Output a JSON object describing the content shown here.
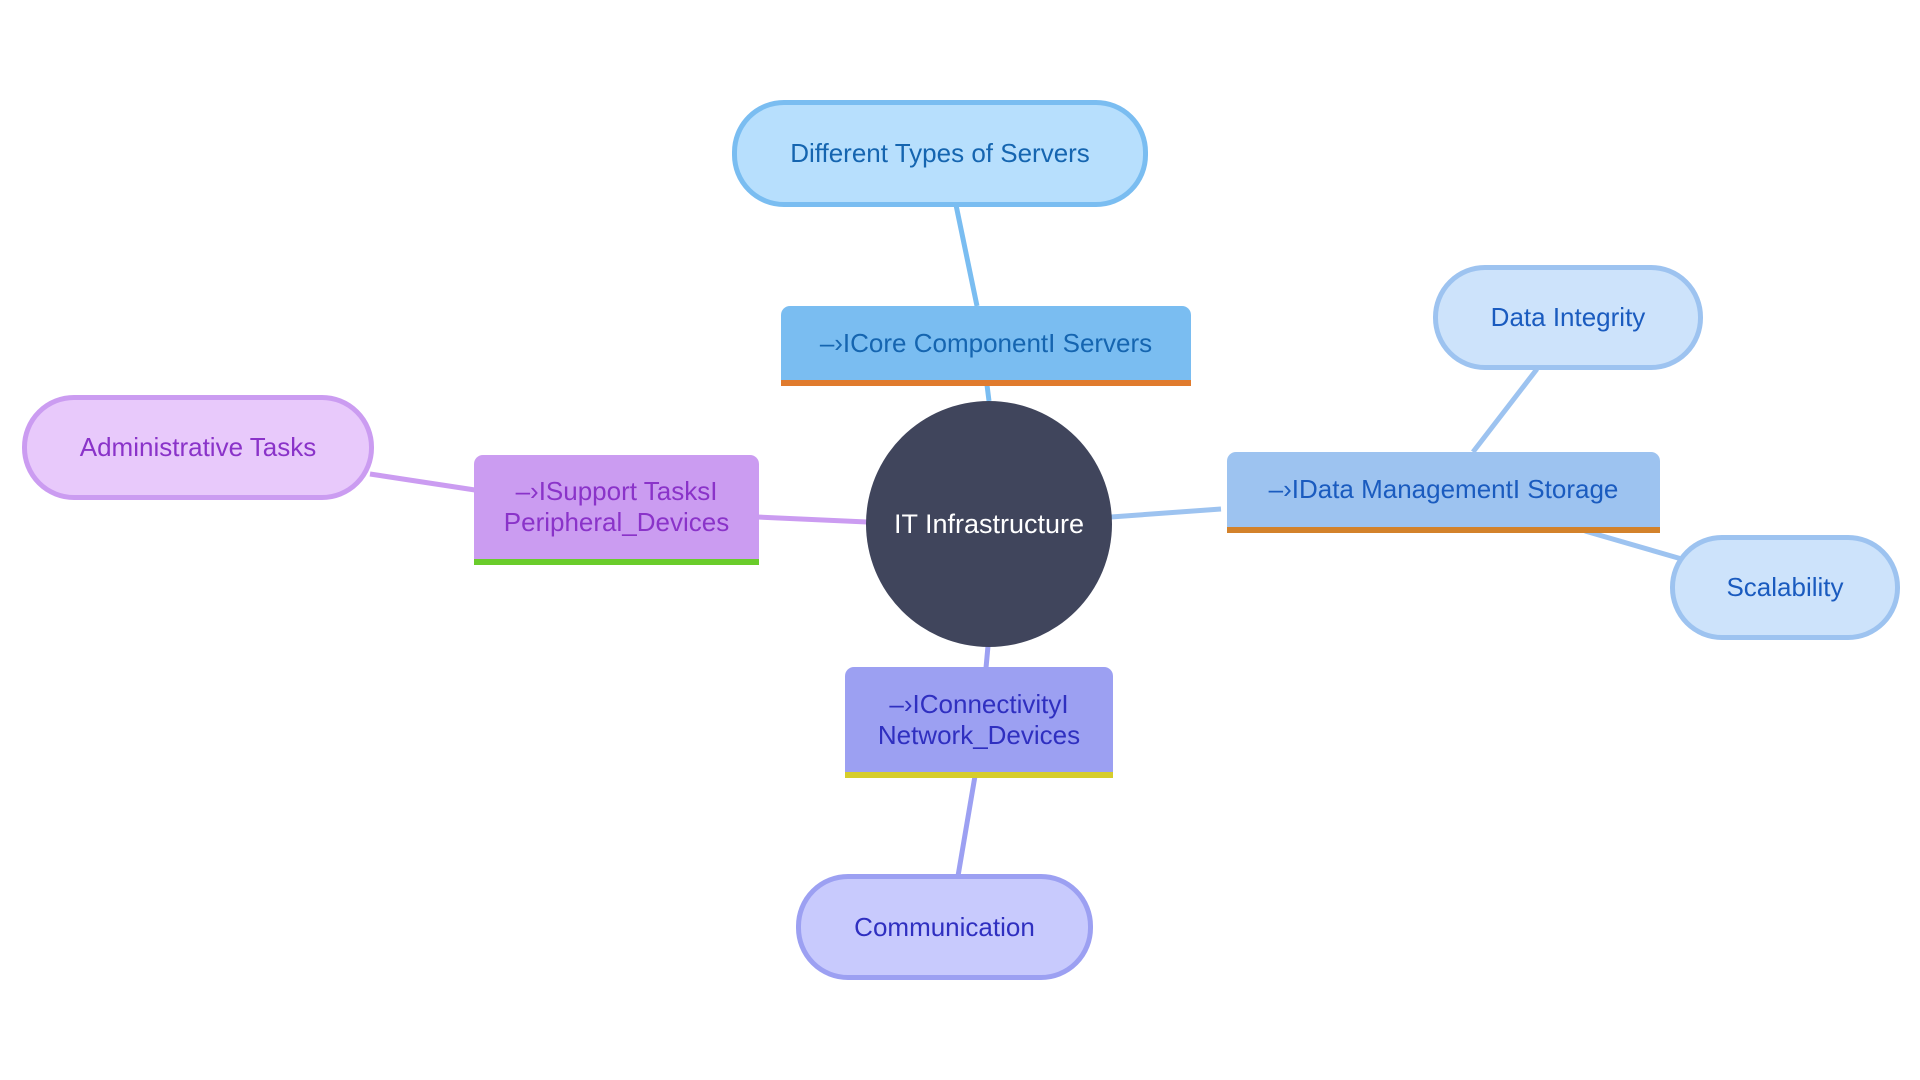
{
  "diagram": {
    "type": "mindmap",
    "root": {
      "label": "IT Infrastructure",
      "fill": "#40455c",
      "text_color": "#ffffff"
    },
    "branches": [
      {
        "id": "servers",
        "label": "–›ICore ComponentI Servers",
        "fill": "#7abdf1",
        "underline": "#e07b2e",
        "text_color": "#1565b0",
        "edge_color": "#7abdf1",
        "children": [
          {
            "id": "types-servers",
            "label": "Different Types of Servers",
            "fill": "#b7dffd",
            "border": "#7abdf1",
            "text_color": "#1565b0"
          }
        ]
      },
      {
        "id": "storage",
        "label": "–›IData ManagementI Storage",
        "fill": "#9dc3f0",
        "underline": "#d3822b",
        "text_color": "#1a5bbf",
        "edge_color": "#9dc3f0",
        "children": [
          {
            "id": "data-integrity",
            "label": "Data Integrity",
            "fill": "#cde3fb",
            "border": "#9dc3f0",
            "text_color": "#1a5bbf"
          },
          {
            "id": "scalability",
            "label": "Scalability",
            "fill": "#cde3fb",
            "border": "#9dc3f0",
            "text_color": "#1a5bbf"
          }
        ]
      },
      {
        "id": "peripheral",
        "label": "–›ISupport TasksI Peripheral_Devices",
        "fill": "#cb9cf1",
        "underline": "#6acc2b",
        "text_color": "#8a33c9",
        "edge_color": "#cb9cf1",
        "children": [
          {
            "id": "admin-tasks",
            "label": "Administrative Tasks",
            "fill": "#e8c9fb",
            "border": "#cb9cf1",
            "text_color": "#8a33c9"
          }
        ]
      },
      {
        "id": "network",
        "label": "–›IConnectivityI Network_Devices",
        "fill": "#9ca0f2",
        "underline": "#d6cd2b",
        "text_color": "#2f2fc0",
        "edge_color": "#9ca0f2",
        "children": [
          {
            "id": "communication",
            "label": "Communication",
            "fill": "#c8cafd",
            "border": "#9ca0f2",
            "text_color": "#2f2fc0"
          }
        ]
      }
    ]
  }
}
